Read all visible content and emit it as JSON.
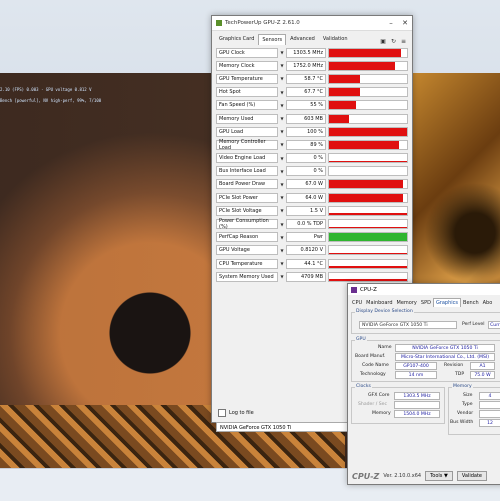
{
  "gpuz": {
    "title": "TechPowerUp GPU-Z 2.61.0",
    "tabs": [
      "Graphics Card",
      "Sensors",
      "Advanced",
      "Validation"
    ],
    "active_tab": "Sensors",
    "sensors": [
      {
        "name": "GPU Clock",
        "value": "1303.5 MHz",
        "color": "#e01010",
        "level": 0.92
      },
      {
        "name": "Memory Clock",
        "value": "1752.0 MHz",
        "color": "#e01010",
        "level": 0.85
      },
      {
        "name": "GPU Temperature",
        "value": "58.7 °C",
        "color": "#e01010",
        "level": 0.4
      },
      {
        "name": "Hot Spot",
        "value": "67.7 °C",
        "color": "#e01010",
        "level": 0.4
      },
      {
        "name": "Fan Speed (%)",
        "value": "55 %",
        "color": "#e01010",
        "level": 0.35
      },
      {
        "name": "Memory Used",
        "value": "603 MB",
        "color": "#e01010",
        "level": 0.25
      },
      {
        "name": "GPU Load",
        "value": "100 %",
        "color": "#e01010",
        "level": 1
      },
      {
        "name": "Memory Controller Load",
        "value": "89 %",
        "color": "#e01010",
        "level": 0.9
      },
      {
        "name": "Video Engine Load",
        "value": "0 %",
        "color": "#e01010",
        "level": 0
      },
      {
        "name": "Bus Interface Load",
        "value": "0 %",
        "color": "#e01010",
        "level": 0
      },
      {
        "name": "Board Power Draw",
        "value": "67.0 W",
        "color": "#e01010",
        "level": 0.95
      },
      {
        "name": "PCIe Slot Power",
        "value": "64.0 W",
        "color": "#e01010",
        "level": 0.95
      },
      {
        "name": "PCIe Slot Voltage",
        "value": "1.5 V",
        "color": "#e01010",
        "level": 0.05
      },
      {
        "name": "Power Consumption (%)",
        "value": "0.0 % TDP",
        "color": "#e01010",
        "level": 0.05
      },
      {
        "name": "PerfCap Reason",
        "value": "Pwr",
        "color": "#2fb52f",
        "level": 1
      },
      {
        "name": "GPU Voltage",
        "value": "0.8120 V",
        "color": "#e01010",
        "level": 0.05
      },
      {
        "name": "CPU Temperature",
        "value": "44.1 °C",
        "color": "#e01010",
        "level": 0.1
      },
      {
        "name": "System Memory Used",
        "value": "4709 MB",
        "color": "#e01010",
        "level": 0.15
      }
    ],
    "log_label": "Log to file",
    "gpu_select": "NVIDIA GeForce GTX 1050 Ti"
  },
  "cpuz": {
    "title": "CPU-Z",
    "tabs": [
      "CPU",
      "Mainboard",
      "Memory",
      "SPD",
      "Graphics",
      "Bench",
      "Abo"
    ],
    "active_tab": "Graphics",
    "display_group": "Display Device Selection",
    "device": "NVIDIA GeForce GTX 1050 Ti",
    "perf_label": "Perf Level",
    "perf_value": "Curr",
    "gpu_group": "GPU",
    "name_label": "Name",
    "name_value": "NVIDIA GeForce GTX 1050 Ti",
    "board_label": "Board Manuf.",
    "board_value": "Micro-Star International Co., Ltd. (MSI)",
    "code_label": "Code Name",
    "code_value": "GP107-400",
    "rev_label": "Revision",
    "rev_value": "A1",
    "tech_label": "Technology",
    "tech_value": "14 nm",
    "tdp_label": "TDP",
    "tdp_value": "75.0 W",
    "clocks_group": "Clocks",
    "gfx_label": "GFX Core",
    "gfx_value": "1303.5 MHz",
    "shader_label": "Shader / Sec",
    "mem_label": "Memory",
    "mem_value": "1504.0 MHz",
    "memory_group": "Memory",
    "size_label": "Size",
    "size_value": "4",
    "type_label": "Type",
    "vendor_label": "Vendor",
    "bus_label": "Bus Width",
    "bus_value": "12",
    "logo": "CPU-Z",
    "version": "Ver. 2.10.0.x64",
    "tools_label": "Tools",
    "validate_label": "Validate"
  },
  "osd": {
    "line1": "2.10 (FPS) 0.003 · GPU voltage 0.812 V",
    "line2": "Bench [powerful], NV high-perf, 99%, 7/100"
  }
}
